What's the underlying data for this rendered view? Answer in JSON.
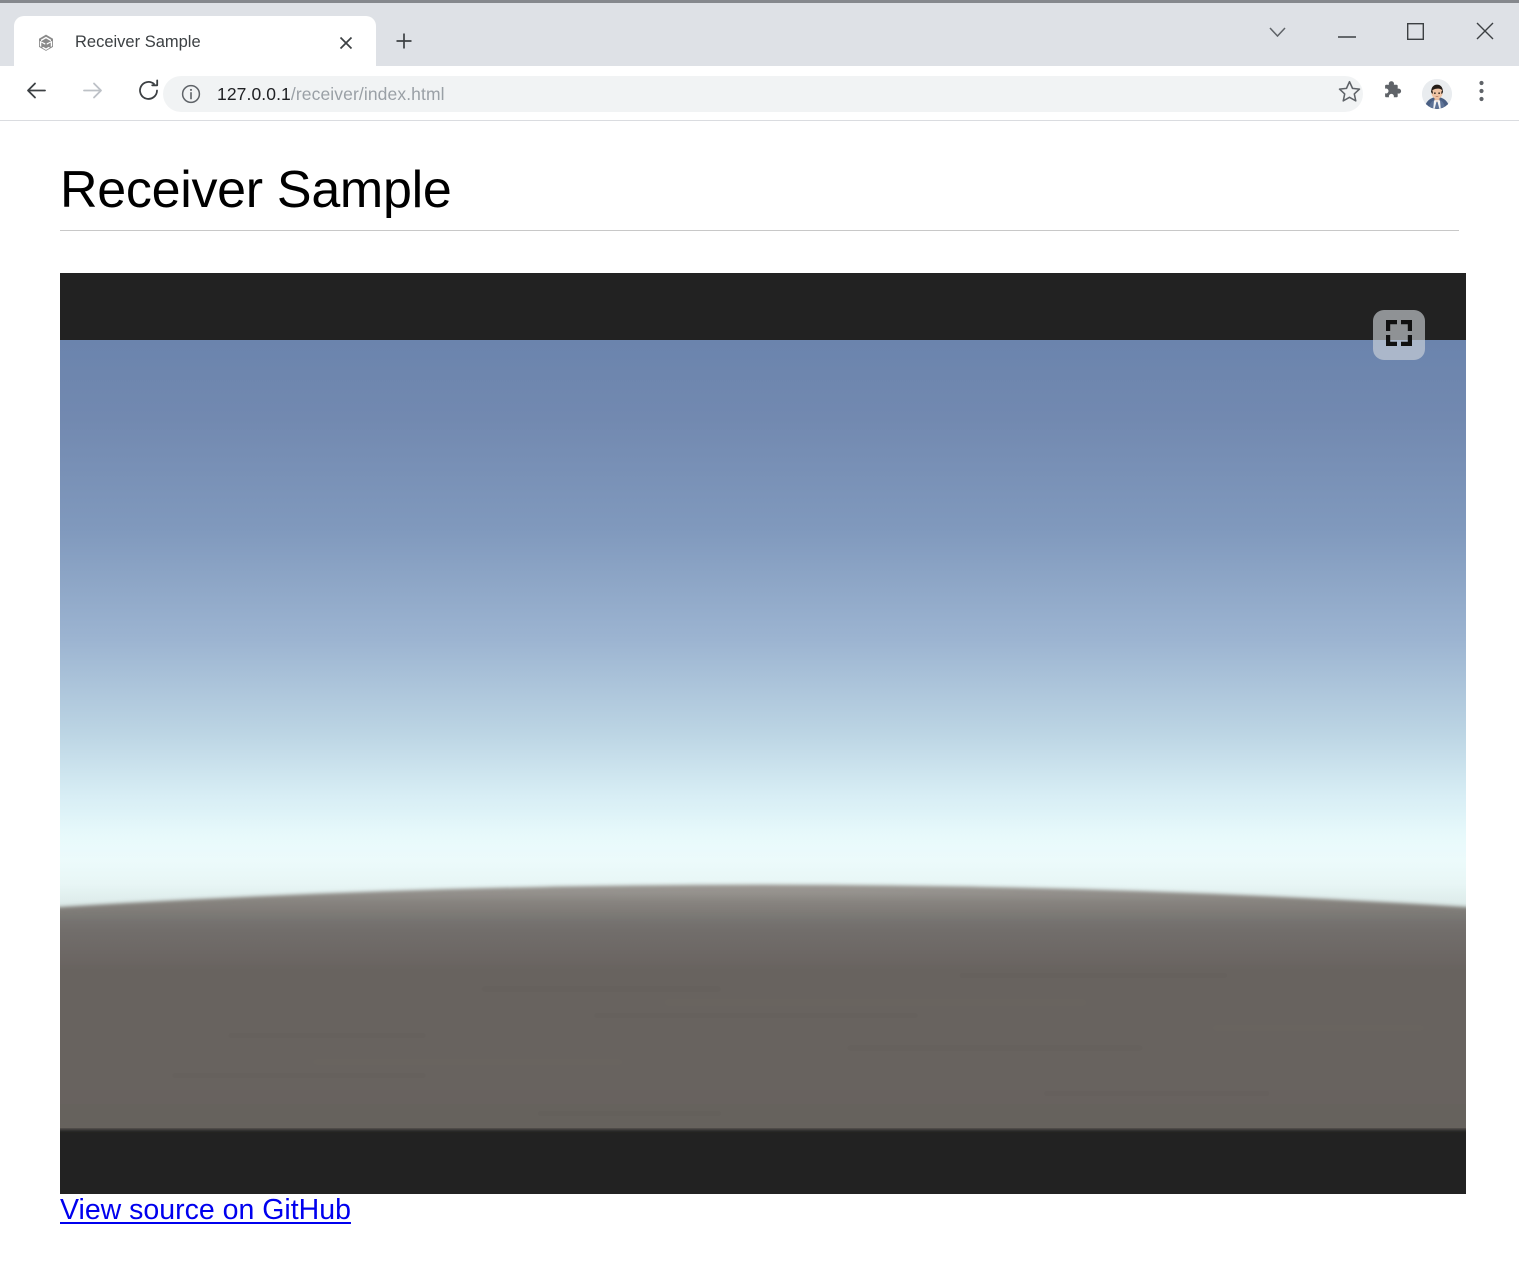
{
  "browser": {
    "tab": {
      "title": "Receiver Sample",
      "favicon_icon": "unity-logo-icon",
      "close_icon": "close-icon"
    },
    "new_tab_button": {
      "icon": "plus-icon",
      "label": "+"
    },
    "window_controls": [
      {
        "name": "tab-search-button",
        "icon": "chevron-down-icon"
      },
      {
        "name": "minimize-button",
        "icon": "minimize-icon"
      },
      {
        "name": "maximize-button",
        "icon": "maximize-icon"
      },
      {
        "name": "close-window-button",
        "icon": "close-icon"
      }
    ],
    "toolbar": {
      "back_icon": "arrow-left-icon",
      "forward_icon": "arrow-right-icon",
      "reload_icon": "reload-icon",
      "omnibox": {
        "site_info_icon": "info-circle-icon",
        "url_host": "127.0.0.1",
        "url_path": "/receiver/index.html",
        "full_url": "127.0.0.1/receiver/index.html"
      },
      "bookmark_icon": "star-icon",
      "extensions_icon": "puzzle-piece-icon",
      "profile_icon": "avatar-photo-icon",
      "menu_icon": "three-dot-menu-icon"
    },
    "colors": {
      "tabstrip_bg": "#dee1e6",
      "toolbar_bg": "#ffffff",
      "omnibox_bg": "#f1f3f4",
      "url_host_color": "#202124",
      "url_path_color": "#9aa0a6"
    }
  },
  "page": {
    "title": "Receiver Sample",
    "divider": true,
    "video": {
      "name": "video-player",
      "letterbox_color": "#222222",
      "fullscreen_button": {
        "icon": "fullscreen-icon",
        "label": "Fullscreen"
      },
      "scene_description": "Unity 3D sky and desert ground render",
      "sky_top_color": "#6b84ad",
      "sky_horizon_color": "#edfcfc",
      "ground_color": "#66625d"
    },
    "github_link": {
      "label": "View source on GitHub",
      "color": "#0000ee"
    }
  }
}
